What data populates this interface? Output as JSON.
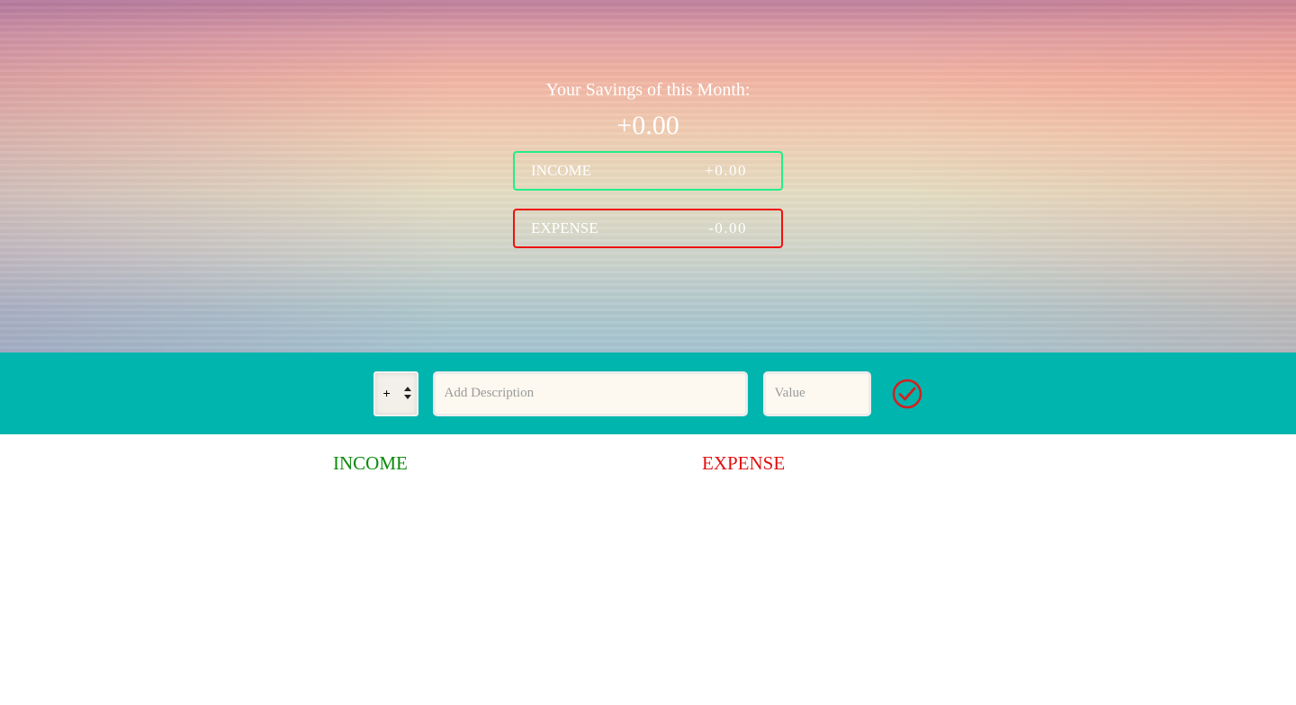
{
  "budget": {
    "title": "Your Savings of this Month:",
    "amount": "+0.00",
    "income_label": "INCOME",
    "income_value": "+0.00",
    "expense_label": "EXPENSE",
    "expense_value": "-0.00"
  },
  "add_form": {
    "type_selected": "+",
    "description_placeholder": "Add Description",
    "value_placeholder": "Value",
    "submit_icon": "check-circle-icon"
  },
  "lists": {
    "income_title": "INCOME",
    "expense_title": "EXPENSE"
  },
  "colors": {
    "add_bar": "#00b5ad",
    "income_border": "#22ee88",
    "expense_border": "#ee1111",
    "income_title": "#0b8a0b",
    "expense_title": "#e01010",
    "submit_icon": "#d42020"
  }
}
